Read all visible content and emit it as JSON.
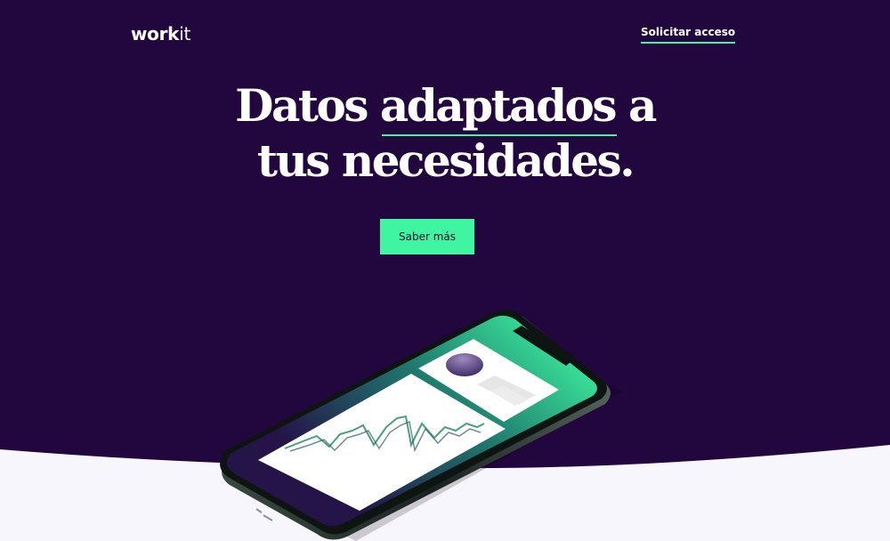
{
  "header": {
    "logo_bold": "work",
    "logo_light": "it",
    "nav_link_label": "Solicitar acceso"
  },
  "hero": {
    "headline_before": "Datos ",
    "headline_highlight": "adaptados",
    "headline_after_line1": " a",
    "headline_line2": "tus necesidades.",
    "cta_label": "Saber más"
  },
  "colors": {
    "background_dark": "#22073f",
    "accent_green": "#3ff5a1",
    "background_light": "#f8f6fd",
    "text_light": "#ffffff"
  },
  "illustration": {
    "icon": "smartphone-with-chart-icon"
  }
}
